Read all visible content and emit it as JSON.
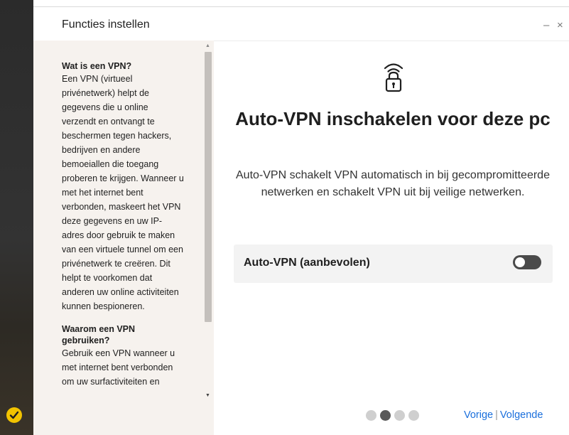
{
  "window": {
    "title": "Functies instellen",
    "minimize_symbol": "–",
    "close_symbol": "×"
  },
  "info_panel": {
    "sections": [
      {
        "heading": "Wat is een VPN?",
        "body": "Een VPN (virtueel privénetwerk) helpt de gegevens die u online verzendt en ontvangt te beschermen tegen hackers, bedrijven en andere bemoeiallen die toegang proberen te krijgen. Wanneer u met het internet bent verbonden, maskeert het VPN deze gegevens en uw IP-adres door gebruik te maken van een virtuele tunnel om een privénetwerk te creëren. Dit helpt te voorkomen dat anderen uw online activiteiten kunnen bespioneren."
      },
      {
        "heading": "Waarom een VPN gebruiken?",
        "body": "Gebruik een VPN wanneer u met internet bent verbonden om uw surfactiviteiten en"
      }
    ]
  },
  "main": {
    "icon": "wifi-lock-icon",
    "headline": "Auto-VPN inschakelen voor deze pc",
    "description": "Auto-VPN schakelt VPN automatisch in bij gecompromitteerde netwerken en schakelt VPN uit bij veilige netwerken.",
    "toggle": {
      "label": "Auto-VPN (aanbevolen)",
      "state": "off"
    }
  },
  "footer": {
    "progress": {
      "total_steps": 4,
      "current_step": 2
    },
    "prev_label": "Vorige",
    "separator": "|",
    "next_label": "Volgende"
  },
  "colors": {
    "accent_link": "#1a6fdc",
    "info_panel_bg": "#f6f2ee",
    "toggle_off": "#4a4a4a",
    "brand_yellow": "#f2c300"
  }
}
